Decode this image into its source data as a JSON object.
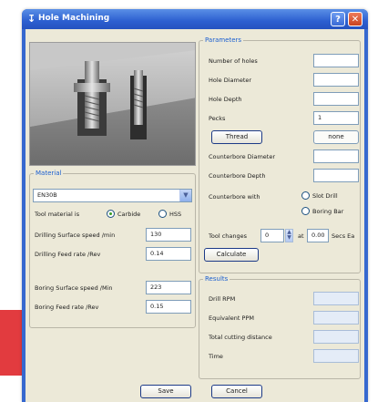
{
  "window": {
    "title": "Hole Machining",
    "help_glyph": "?",
    "close_glyph": "✕"
  },
  "parameters": {
    "legend": "Parameters",
    "number_of_holes": "Number of holes",
    "hole_diameter": "Hole Diameter",
    "hole_depth": "Hole Depth",
    "pecks": "Pecks",
    "pecks_value": "1",
    "thread_button": "Thread",
    "thread_value": "none",
    "counterbore_diameter": "Counterbore Diameter",
    "counterbore_depth": "Counterbore Depth",
    "counterbore_with": "Counterbore with",
    "slot_drill": "Slot Drill",
    "boring_bar": "Boring Bar",
    "tool_changes": "Tool changes",
    "tool_changes_value": "0",
    "at": "at",
    "secs_value": "0.00",
    "secs_unit": "Secs Ea",
    "calculate_button": "Calculate"
  },
  "material": {
    "legend": "Material",
    "selected": "EN30B",
    "tool_material_label": "Tool material is",
    "carbide": "Carbide",
    "hss": "HSS",
    "tool_material_selected": "Carbide",
    "drilling_speed_label": "Drilling Surface speed /min",
    "drilling_speed_value": "130",
    "drilling_feed_label": "Drilling Feed rate /Rev",
    "drilling_feed_value": "0.14",
    "boring_speed_label": "Boring Surface speed /Min",
    "boring_speed_value": "223",
    "boring_feed_label": "Boring Feed rate /Rev",
    "boring_feed_value": "0.15"
  },
  "results": {
    "legend": "Results",
    "drill_rpm": "Drill RPM",
    "equivalent_ppm": "Equivalent PPM",
    "total_cutting_distance": "Total cutting distance",
    "time": "Time"
  },
  "footer": {
    "save_button": "Save",
    "cancel_button": "Cancel"
  },
  "colors": {
    "titlebar": "#2c5fd0",
    "client": "#ece9d8",
    "legend_text": "#1b5fd0",
    "accent_red": "#e23b3f"
  }
}
